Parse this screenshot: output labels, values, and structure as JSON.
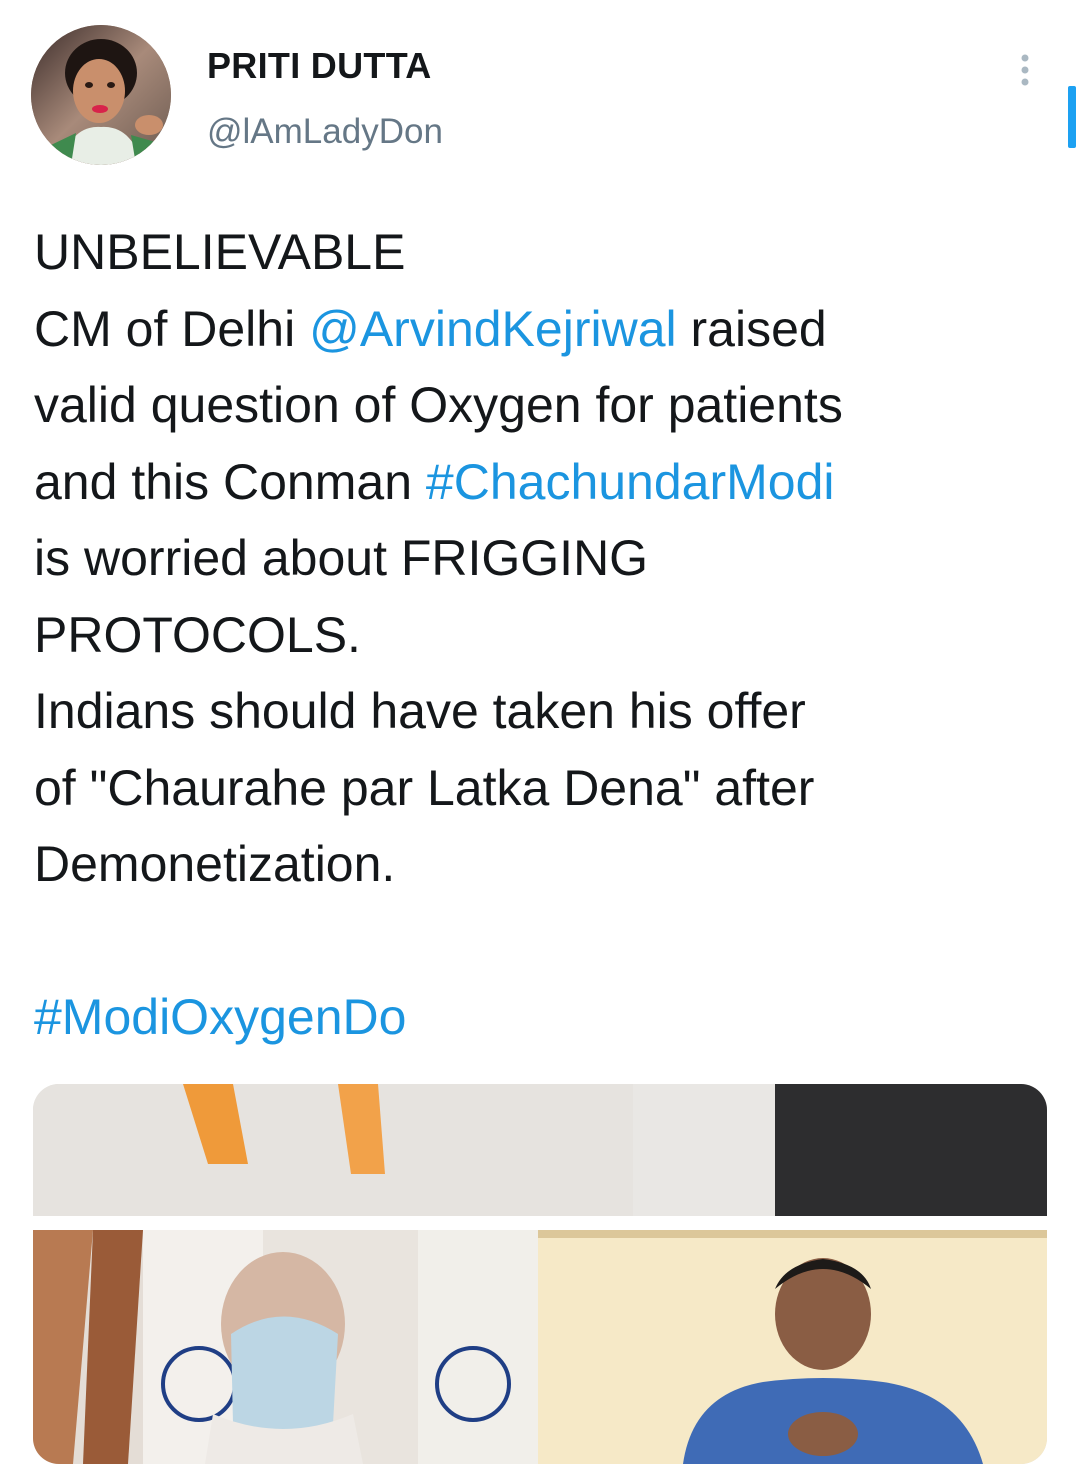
{
  "tweet": {
    "author": {
      "display_name": "PRITI DUTTA",
      "handle": "@lAmLadyDon"
    },
    "more_icon": "vertical-ellipsis-icon",
    "text": {
      "line1": "UNBELIEVABLE",
      "line2_a": "CM of Delhi ",
      "line2_mention": "@ArvindKejriwal",
      "line2_b": " raised",
      "line3": "valid question of Oxygen for patients",
      "line4_a": "and this Conman ",
      "line4_hashtag": "#ChachundarModi",
      "line5": "is worried about FRIGGING",
      "line6": "PROTOCOLS.",
      "line7": "Indians should have taken his offer",
      "line8": "of \"Chaurahe par Latka Dena\" after",
      "line9": "Demonetization.",
      "hashtag_final": "#ModiOxygenDo"
    }
  },
  "colors": {
    "link": "#1b95e0",
    "text": "#14171a",
    "secondary": "#657786",
    "scroll_accent": "#1da1f2"
  }
}
